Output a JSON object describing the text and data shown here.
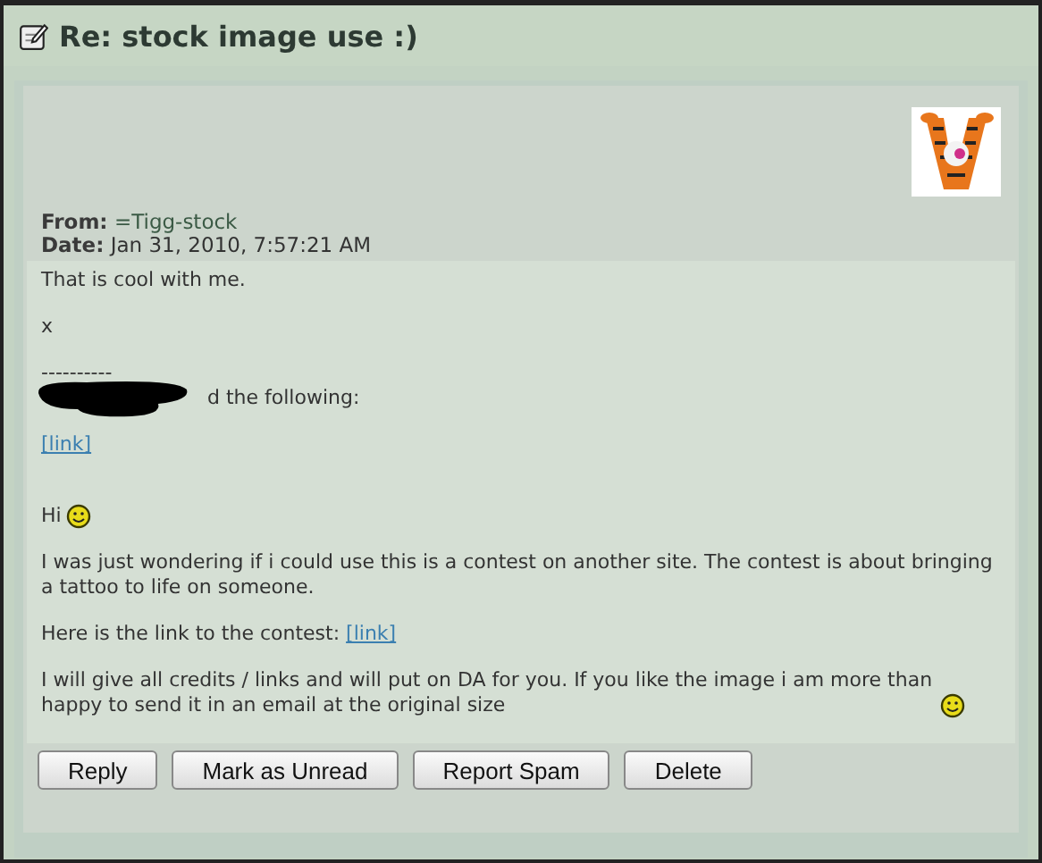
{
  "window": {
    "title": "Re: stock image use :)"
  },
  "header": {
    "from_label": "From:",
    "from": "=Tigg-stock",
    "date_label": "Date:",
    "date": "Jan 31, 2010, 7:57:21 AM"
  },
  "message": [
    {
      "kind": "text",
      "text": "That is cool with me."
    },
    {
      "kind": "text",
      "text": "x"
    },
    {
      "kind": "rule",
      "text": "----------"
    },
    {
      "kind": "redacted",
      "text": "d the following:"
    },
    {
      "kind": "link",
      "text": "[link]"
    },
    {
      "kind": "smiley",
      "text": "Hi"
    },
    {
      "kind": "text",
      "text": "I was just wondering if i could use this is a contest on another site. The contest is about bringing a tattoo to life on someone."
    },
    {
      "kind": "text_link",
      "text": "Here is the link to the contest:",
      "link": "[link]"
    },
    {
      "kind": "smiley",
      "text": "I will give all credits / links and will put on DA for you. If you like the image i am more than happy to send it in an email at the original size"
    }
  ],
  "buttons": [
    "Reply",
    "Mark as Unread",
    "Report Spam",
    "Delete"
  ]
}
